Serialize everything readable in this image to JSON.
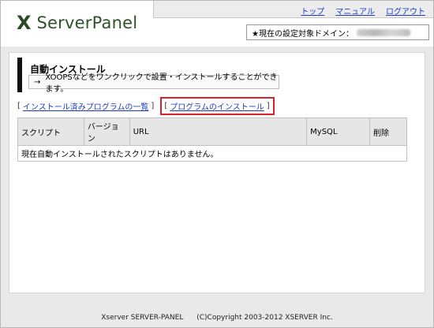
{
  "brand": {
    "mark": "X",
    "name": "ServerPanel"
  },
  "topnav": {
    "top": "トップ",
    "manual": "マニュアル",
    "logout": "ログアウト"
  },
  "domain": {
    "label": "★現在の設定対象ドメイン："
  },
  "page": {
    "title": "自動インストール",
    "arrow": "→",
    "description": "XOOPSなどをワンクリックで設置・インストールすることができます。"
  },
  "links": {
    "open_bracket": "[",
    "close_bracket": "]",
    "installed_list": "インストール済みプログラムの一覧",
    "install_program": "プログラムのインストール"
  },
  "table": {
    "headers": [
      "スクリプト",
      "バージョン",
      "URL",
      "MySQL",
      "削除"
    ],
    "empty_message": "現在自動インストールされたスクリプトはありません。"
  },
  "footer": {
    "product": "Xserver SERVER-PANEL",
    "copyright": "(C)Copyright 2003-2012 XSERVER Inc."
  },
  "colors": {
    "brand": "#2f5227",
    "link": "#1a3cc8",
    "highlight": "#d9202c"
  },
  "icons": [
    "arrow-right-icon"
  ]
}
